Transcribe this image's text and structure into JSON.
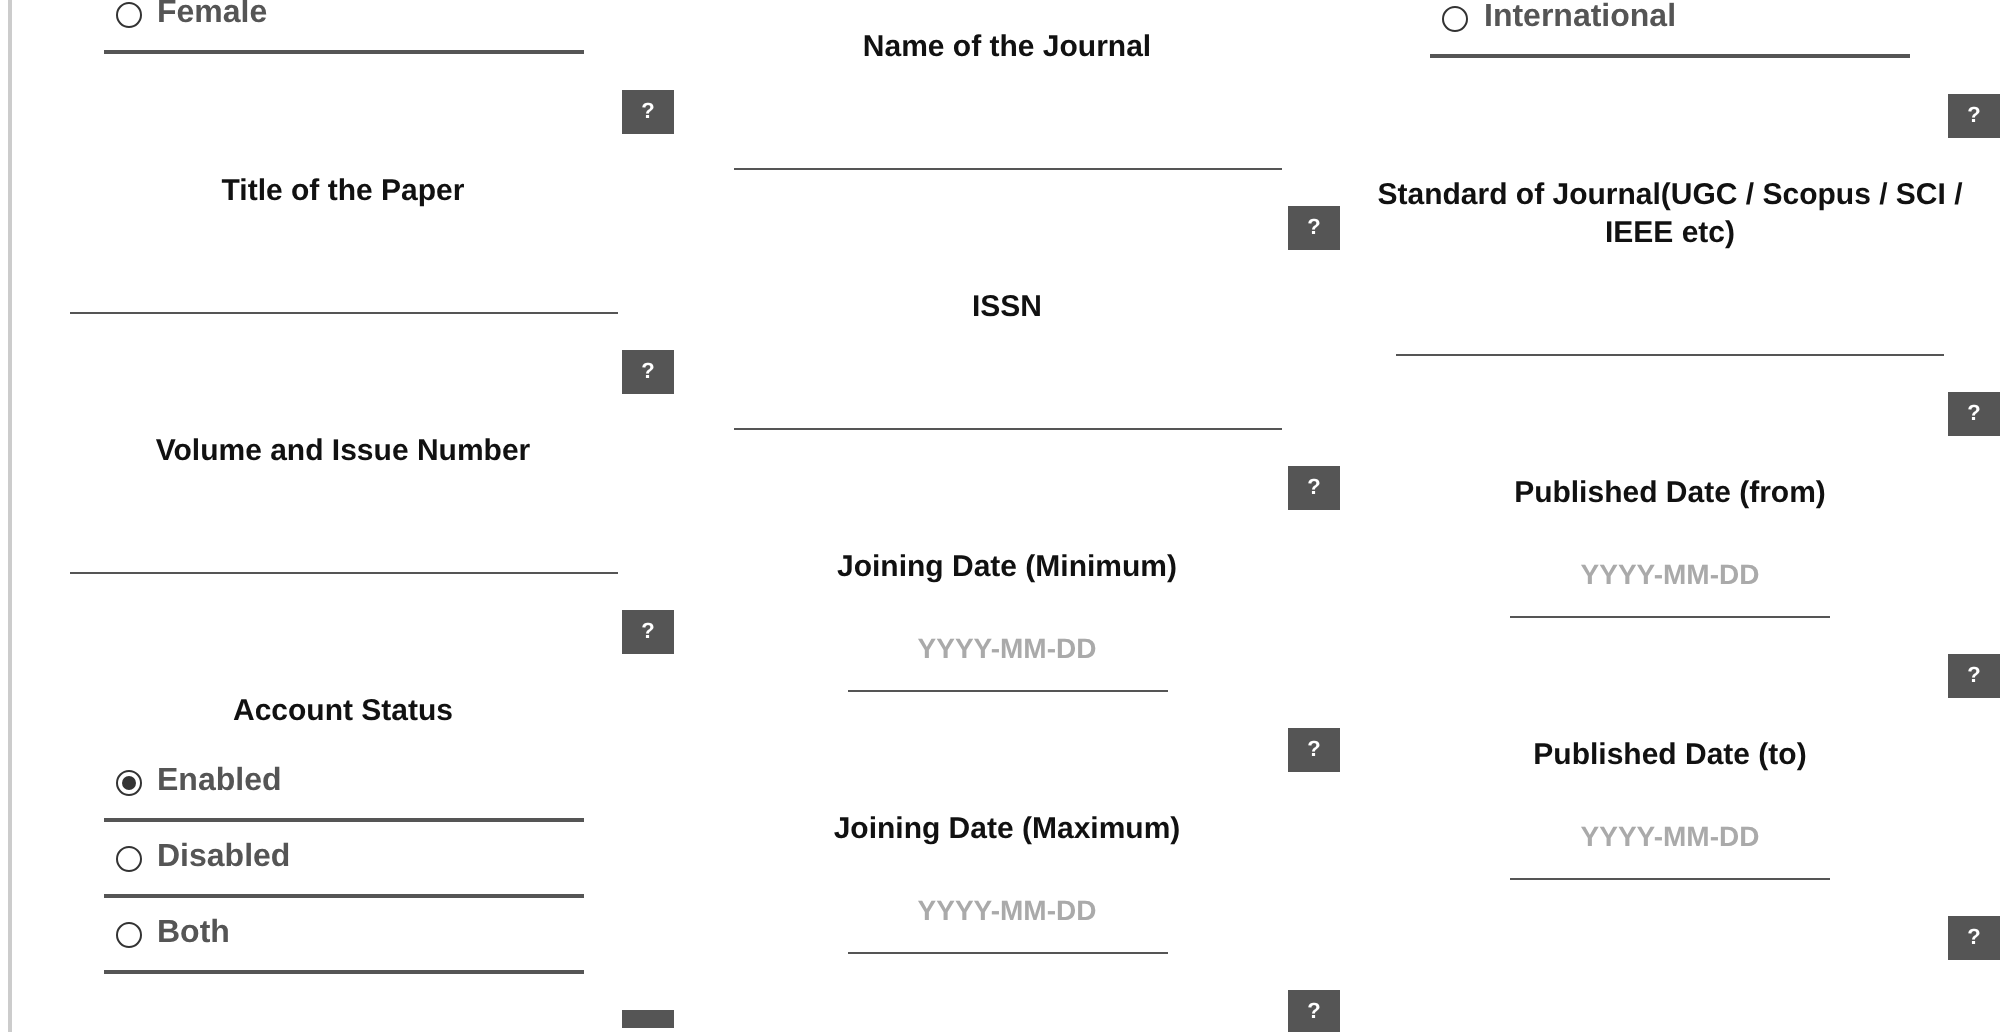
{
  "columns": [
    {
      "items": [
        {
          "kind": "radio_option",
          "label": "Female",
          "selected": false
        },
        {
          "kind": "help",
          "label": "?"
        },
        {
          "kind": "text_field",
          "label": "Title of the Paper"
        },
        {
          "kind": "help",
          "label": "?"
        },
        {
          "kind": "text_field",
          "label": "Volume and Issue Number"
        },
        {
          "kind": "help",
          "label": "?"
        },
        {
          "kind": "radio_group",
          "label": "Account Status",
          "options": [
            {
              "label": "Enabled",
              "selected": true
            },
            {
              "label": "Disabled",
              "selected": false
            },
            {
              "label": "Both",
              "selected": false
            }
          ]
        },
        {
          "kind": "help_cut"
        }
      ]
    },
    {
      "items": [
        {
          "kind": "text_field",
          "label": "Name of the Journal"
        },
        {
          "kind": "help",
          "label": "?"
        },
        {
          "kind": "text_field",
          "label": "ISSN"
        },
        {
          "kind": "help",
          "label": "?"
        },
        {
          "kind": "date_field",
          "label": "Joining Date (Minimum)",
          "placeholder": "YYYY-MM-DD"
        },
        {
          "kind": "help",
          "label": "?"
        },
        {
          "kind": "date_field",
          "label": "Joining Date (Maximum)",
          "placeholder": "YYYY-MM-DD"
        },
        {
          "kind": "help",
          "label": "?"
        }
      ]
    },
    {
      "items": [
        {
          "kind": "radio_option",
          "label": "International",
          "selected": false
        },
        {
          "kind": "help",
          "label": "?"
        },
        {
          "kind": "text_field",
          "label": "Standard of Journal(UGC / Scopus / SCI / IEEE etc)"
        },
        {
          "kind": "help",
          "label": "?"
        },
        {
          "kind": "date_field",
          "label": "Published Date (from)",
          "placeholder": "YYYY-MM-DD"
        },
        {
          "kind": "help",
          "label": "?"
        },
        {
          "kind": "date_field",
          "label": "Published Date (to)",
          "placeholder": "YYYY-MM-DD"
        },
        {
          "kind": "help",
          "label": "?"
        }
      ]
    }
  ]
}
